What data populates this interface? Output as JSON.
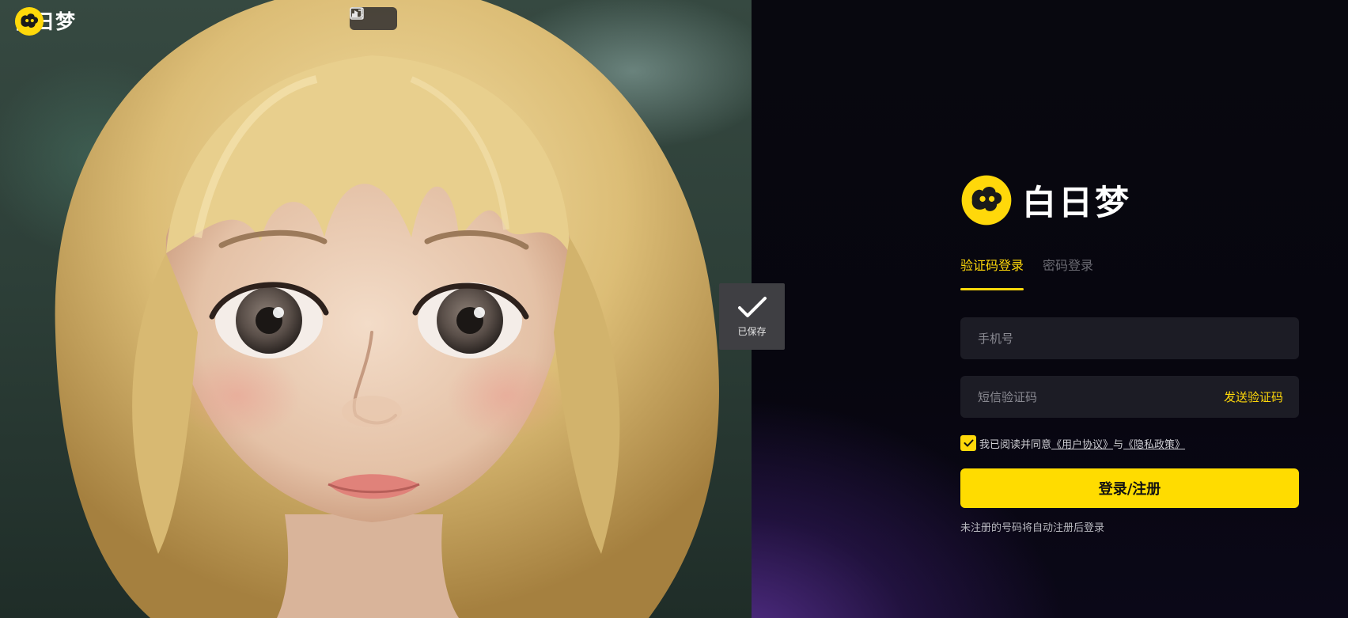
{
  "brand": {
    "name": "白日梦",
    "logo_color": "#ffd80a"
  },
  "hero": {
    "image": "blonde-girl-portrait",
    "media_tools": [
      {
        "icon": "picture-in-picture-icon"
      },
      {
        "icon": "video-magic-icon"
      }
    ],
    "saved_toast": {
      "label": "已保存",
      "icon": "checkmark-icon"
    }
  },
  "login": {
    "tabs": [
      {
        "label": "验证码登录",
        "active": true
      },
      {
        "label": "密码登录",
        "active": false
      }
    ],
    "phone_placeholder": "手机号",
    "code_placeholder": "短信验证码",
    "send_code_label": "发送验证码",
    "agreement": {
      "checked": true,
      "prefix": "我已阅读并同意",
      "user_agreement": "《用户协议》",
      "conjunction": "与",
      "privacy_policy": "《隐私政策》"
    },
    "submit_label": "登录/注册",
    "hint": "未注册的号码将自动注册后登录"
  },
  "colors": {
    "accent": "#ffd80a",
    "panel_bg": "#07060f",
    "input_bg": "#1c1c25"
  }
}
